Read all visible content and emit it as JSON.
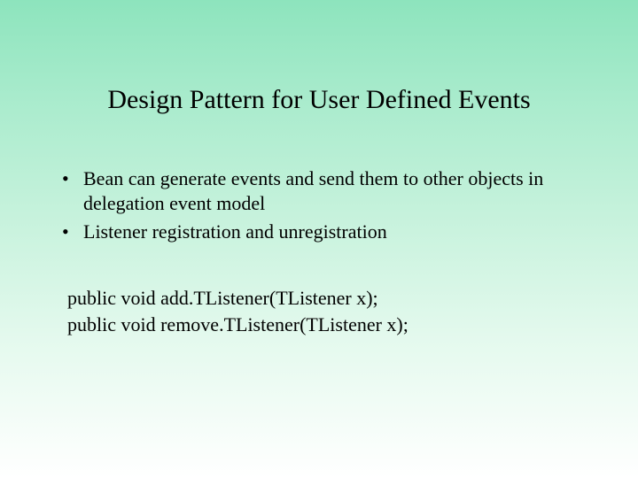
{
  "title": "Design Pattern for User Defined Events",
  "bullets": [
    "Bean can generate events and send them to other objects in delegation event model",
    "Listener registration and unregistration"
  ],
  "code": [
    "public void add.TListener(TListener x);",
    "public void remove.TListener(TListener x);"
  ]
}
